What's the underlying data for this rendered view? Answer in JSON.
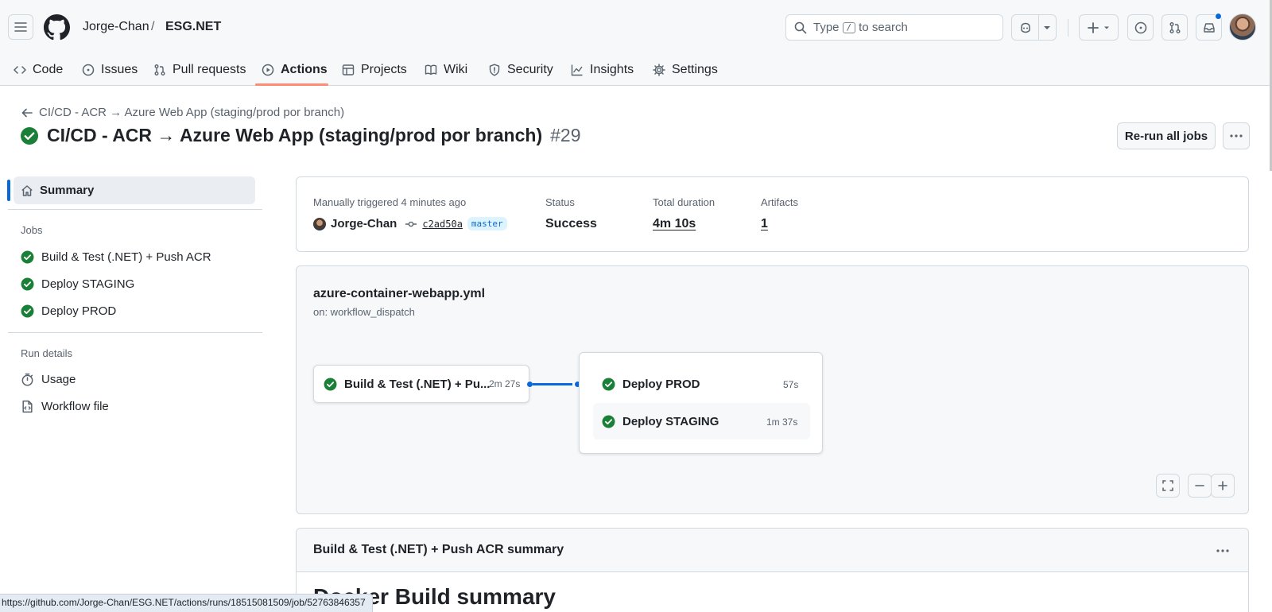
{
  "header": {
    "owner": "Jorge-Chan",
    "separator": "/",
    "repo": "ESG.NET",
    "search_prefix": "Type",
    "search_key": "/",
    "search_suffix": "to search"
  },
  "repo_nav": [
    {
      "label": "Code",
      "icon": "code-icon"
    },
    {
      "label": "Issues",
      "icon": "issue-opened-icon"
    },
    {
      "label": "Pull requests",
      "icon": "git-pull-request-icon"
    },
    {
      "label": "Actions",
      "icon": "play-icon",
      "active": true
    },
    {
      "label": "Projects",
      "icon": "table-icon"
    },
    {
      "label": "Wiki",
      "icon": "book-icon"
    },
    {
      "label": "Security",
      "icon": "shield-icon"
    },
    {
      "label": "Insights",
      "icon": "graph-icon"
    },
    {
      "label": "Settings",
      "icon": "gear-icon"
    }
  ],
  "run": {
    "back_label": "CI/CD - ACR → Azure Web App (staging/prod por branch)",
    "title": "CI/CD - ACR → Azure Web App (staging/prod por branch)",
    "number": "#29",
    "rerun_label": "Re-run all jobs",
    "status_color": "#1a7f37"
  },
  "sidebar": {
    "summary_label": "Summary",
    "jobs_heading": "Jobs",
    "jobs": [
      {
        "label": "Build & Test (.NET) + Push ACR"
      },
      {
        "label": "Deploy STAGING"
      },
      {
        "label": "Deploy PROD"
      }
    ],
    "run_details_heading": "Run details",
    "details": [
      {
        "label": "Usage",
        "icon": "stopwatch-icon"
      },
      {
        "label": "Workflow file",
        "icon": "file-code-icon"
      }
    ]
  },
  "summary": {
    "trigger_label": "Manually triggered 4 minutes ago",
    "user": "Jorge-Chan",
    "commit": "c2ad50a",
    "branch": "master",
    "status_label": "Status",
    "status_value": "Success",
    "duration_label": "Total duration",
    "duration_value": "4m 10s",
    "artifacts_label": "Artifacts",
    "artifacts_value": "1"
  },
  "graph": {
    "workflow_file": "azure-container-webapp.yml",
    "trigger": "on: workflow_dispatch",
    "build_job": {
      "label": "Build & Test (.NET) + Pu...",
      "time": "2m 27s"
    },
    "deploy_jobs": [
      {
        "label": "Deploy PROD",
        "time": "57s"
      },
      {
        "label": "Deploy STAGING",
        "time": "1m 37s"
      }
    ],
    "connector_color": "#0969da"
  },
  "job_summary": {
    "title": "Build & Test (.NET) + Push ACR summary",
    "heading": "Docker Build summary"
  },
  "status_bar": {
    "url": "https://github.com/Jorge-Chan/ESG.NET/actions/runs/18515081509/job/52763846357"
  }
}
